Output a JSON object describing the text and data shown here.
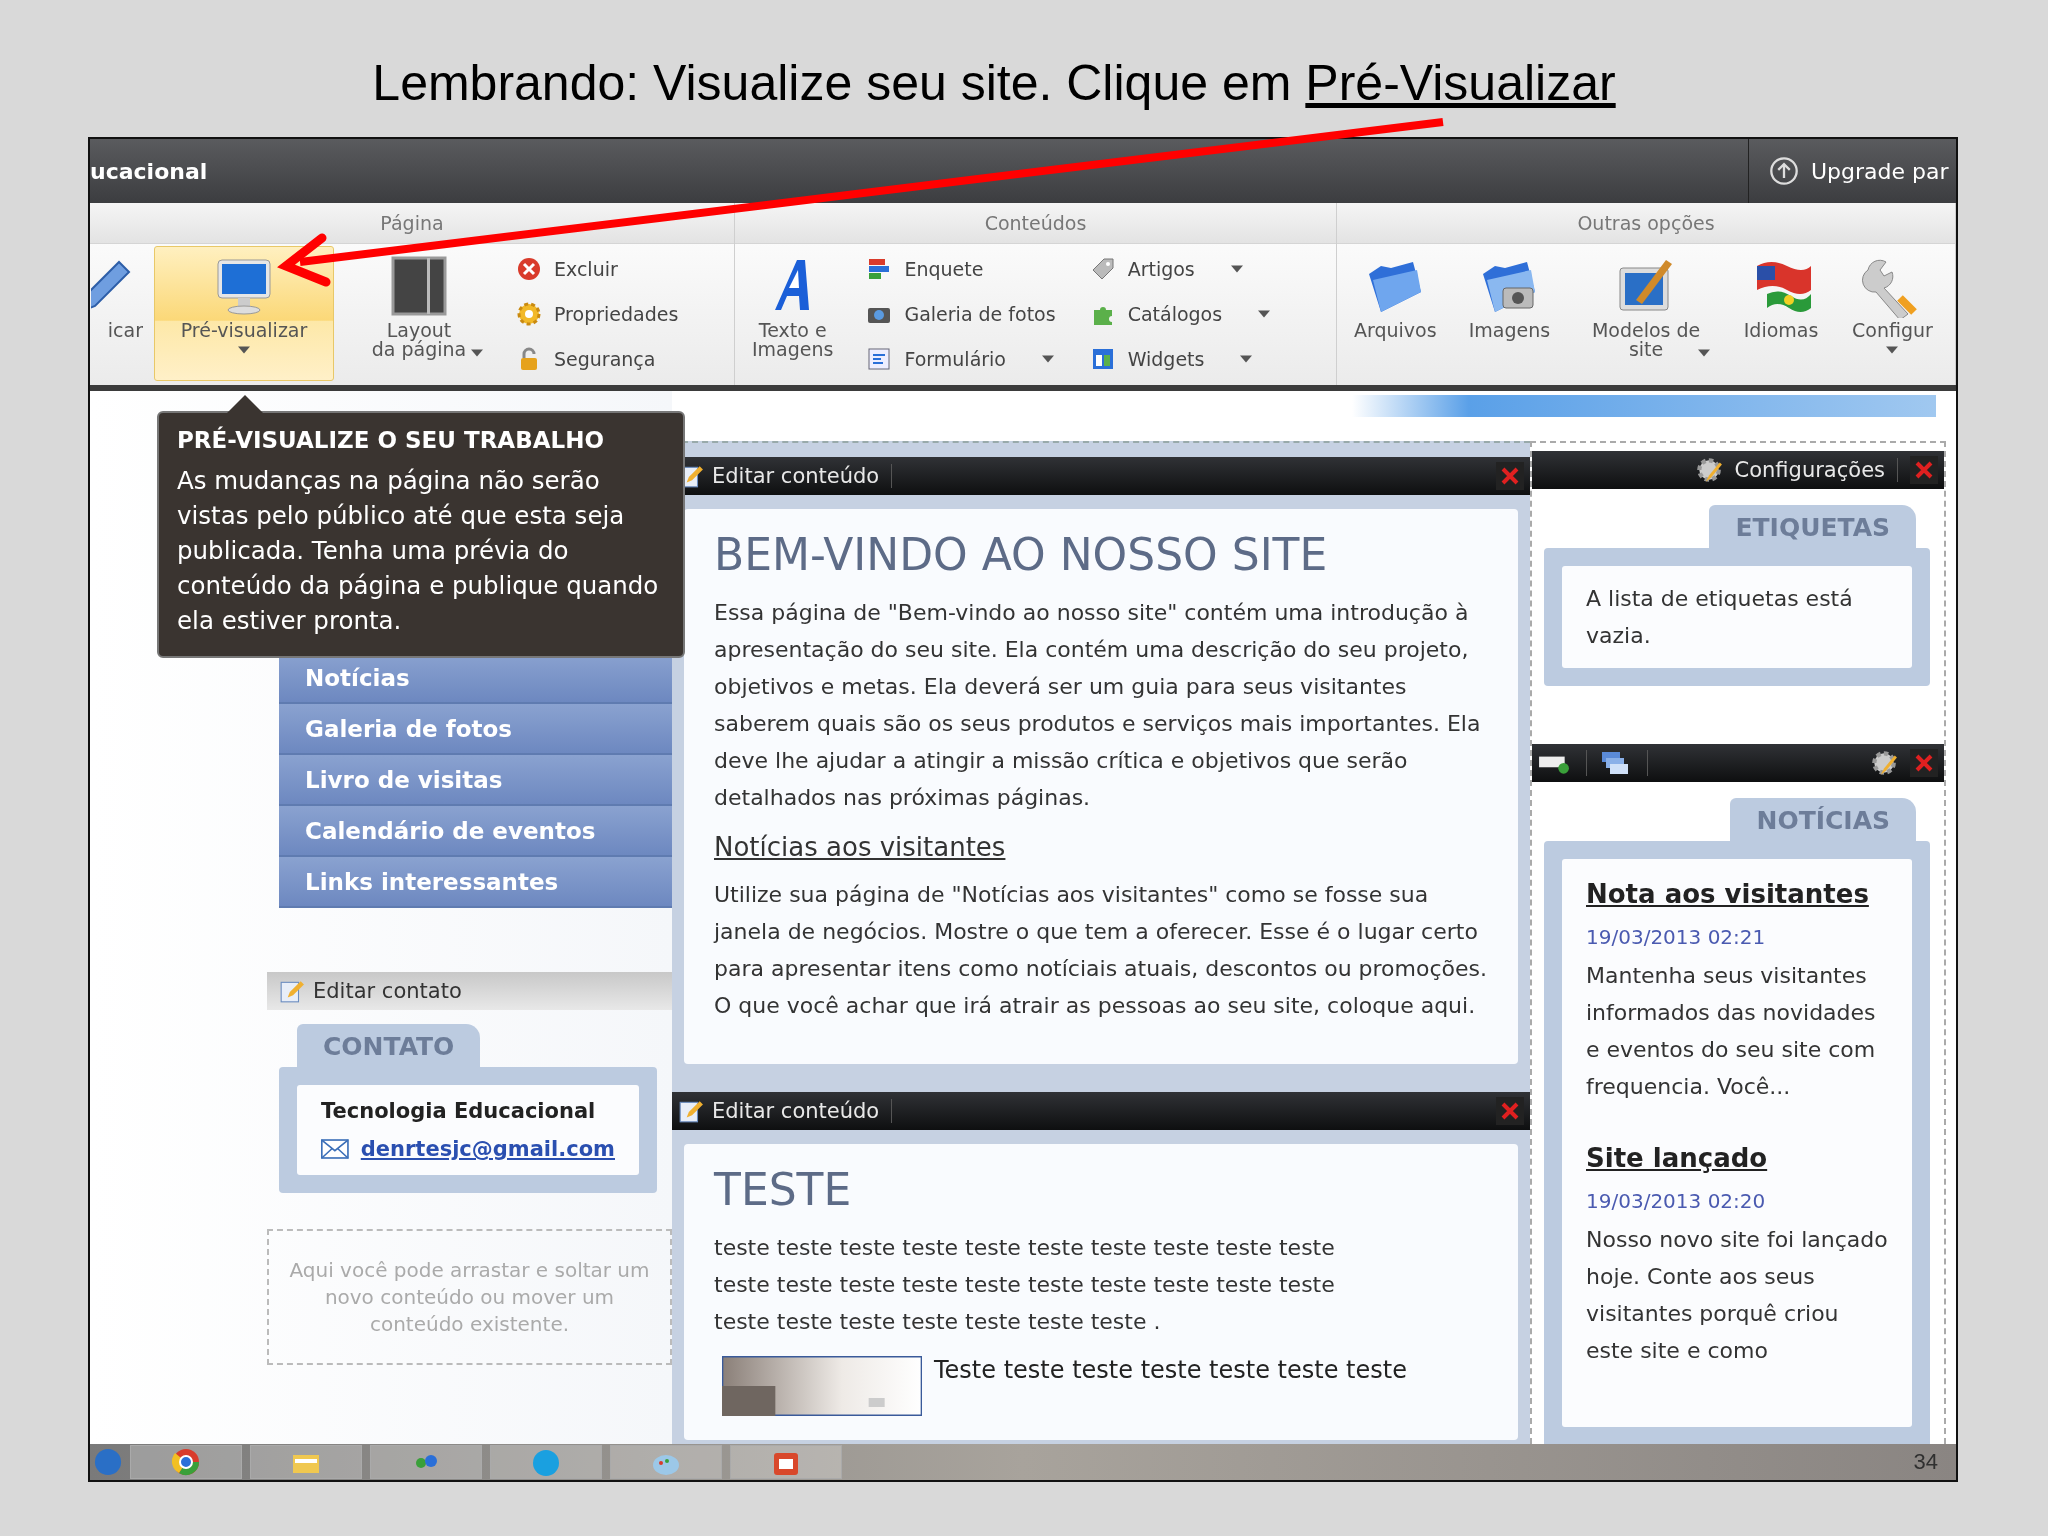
{
  "slide": {
    "title": "Lembrando: Visualize seu site. Clique em",
    "title_link": "Pré-Visualizar",
    "slide_number": "34"
  },
  "window": {
    "title": "ucacional",
    "upgrade": "Upgrade par"
  },
  "ribbon": {
    "groups": [
      {
        "label": "Página",
        "items": [
          {
            "kind": "large",
            "label": "icar",
            "highlighted": false,
            "dropdown": false
          },
          {
            "kind": "large",
            "label": "Pré-visualizar",
            "highlighted": true,
            "dropdown": true
          },
          {
            "kind": "large",
            "label": "Layout\nda página",
            "highlighted": false,
            "dropdown": true
          },
          {
            "kind": "column",
            "entries": [
              {
                "label": "Excluir",
                "dropdown": false
              },
              {
                "label": "Propriedades",
                "dropdown": false
              },
              {
                "label": "Segurança",
                "dropdown": false
              }
            ]
          }
        ]
      },
      {
        "label": "Conteúdos",
        "items": [
          {
            "kind": "large",
            "label": "Texto e\nImagens",
            "highlighted": false,
            "dropdown": false
          },
          {
            "kind": "column",
            "entries": [
              {
                "label": "Enquete",
                "dropdown": false
              },
              {
                "label": "Galeria de fotos",
                "dropdown": false
              },
              {
                "label": "Formulário",
                "dropdown": true
              }
            ]
          },
          {
            "kind": "column",
            "entries": [
              {
                "label": "Artigos",
                "dropdown": true
              },
              {
                "label": "Catálogos",
                "dropdown": true
              },
              {
                "label": "Widgets",
                "dropdown": true
              }
            ]
          }
        ]
      },
      {
        "label": "Outras opções",
        "items": [
          {
            "kind": "large",
            "label": "Arquivos",
            "highlighted": false,
            "dropdown": false
          },
          {
            "kind": "large",
            "label": "Imagens",
            "highlighted": false,
            "dropdown": false
          },
          {
            "kind": "large",
            "label": "Modelos de\nsite",
            "highlighted": false,
            "dropdown": true
          },
          {
            "kind": "large",
            "label": "Idiomas",
            "highlighted": false,
            "dropdown": false
          },
          {
            "kind": "large",
            "label": "Configur",
            "highlighted": false,
            "dropdown": true
          }
        ]
      }
    ]
  },
  "tooltip": {
    "title": "PRÉ-VISUALIZE O SEU TRABALHO",
    "text": "As mudanças na página não serão vistas pelo público até que esta seja publicada. Tenha uma prévia do conteúdo da página e publique quando ela estiver pronta."
  },
  "nav": {
    "items": [
      "Notícias",
      "Galeria de fotos",
      "Livro de visitas",
      "Calendário de eventos",
      "Links interessantes"
    ]
  },
  "contact": {
    "header": "Editar contato",
    "tab": "CONTATO",
    "name": "Tecnologia Educacional",
    "email": "denrtesjc@gmail.com"
  },
  "drop_zone": "Aqui você pode arrastar e soltar um novo conteúdo ou mover um conteúdo existente.",
  "content_widgets": [
    {
      "header": "Editar conteúdo",
      "title": "BEM-VINDO AO NOSSO SITE",
      "blocks": [
        {
          "kind": "paragraph",
          "text": "Essa página de \"Bem-vindo ao nosso site\" contém uma introdução à apresentação do seu site. Ela contém uma descrição do seu projeto, objetivos e metas. Ela deverá ser um guia para seus visitantes saberem quais são os seus produtos e serviços mais importantes. Ela deve lhe ajudar a atingir a missão crítica e objetivos que serão detalhados nas próximas páginas."
        },
        {
          "kind": "heading",
          "text": "Notícias aos visitantes"
        },
        {
          "kind": "paragraph",
          "text": "Utilize sua página de \"Notícias aos visitantes\" como se fosse sua janela de negócios. Mostre o que tem a oferecer. Esse é o lugar certo para apresentar itens como notíciais atuais, descontos ou promoções. O que você achar que irá atrair as pessoas ao seu site, coloque aqui."
        }
      ]
    },
    {
      "header": "Editar conteúdo",
      "title": "TESTE",
      "blocks": [
        {
          "kind": "paragraph",
          "text": "teste teste teste teste teste teste teste teste teste teste teste teste teste teste teste teste teste teste teste teste teste teste teste teste teste teste teste ."
        },
        {
          "kind": "image_text",
          "text": "Teste teste teste teste teste teste teste"
        }
      ]
    }
  ],
  "tags_widget": {
    "header": "Configurações",
    "tab": "ETIQUETAS",
    "text": "A lista de etiquetas está vazia."
  },
  "news_widget": {
    "tab": "NOTÍCIAS",
    "items": [
      {
        "title": "Nota aos visitantes",
        "date": "19/03/2013 02:21",
        "text": "Mantenha seus visitantes informados das novidades e eventos do seu site com frequencia. Você..."
      },
      {
        "title": "Site lançado",
        "date": "19/03/2013 02:20",
        "text": "Nosso novo site foi lançado hoje. Conte aos seus visitantes porquê criou este site e como"
      }
    ]
  }
}
